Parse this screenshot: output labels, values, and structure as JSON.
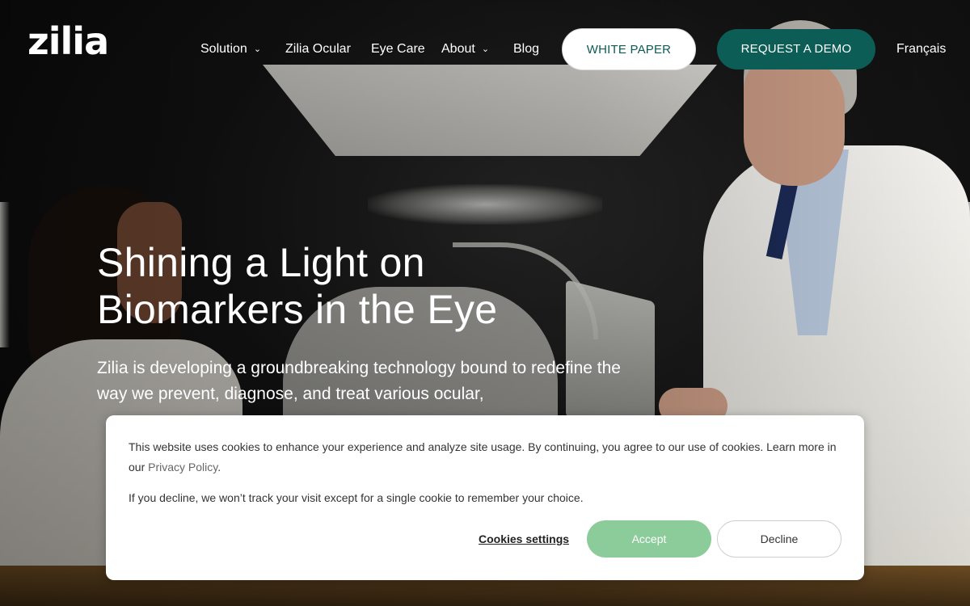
{
  "brand": {
    "logo_text": "zilia"
  },
  "nav": {
    "items": [
      {
        "label": "Solution",
        "has_dropdown": true
      },
      {
        "label": "Zilia Ocular",
        "has_dropdown": false
      },
      {
        "label": "Eye Care",
        "has_dropdown": false
      },
      {
        "label": "About",
        "has_dropdown": true
      },
      {
        "label": "Blog",
        "has_dropdown": false
      }
    ],
    "white_paper_label": "WHITE PAPER",
    "request_demo_label": "REQUEST A DEMO",
    "language_label": "Français"
  },
  "hero": {
    "title_line1": "Shining a Light on",
    "title_line2": "Biomarkers in the Eye",
    "description": "Zilia is developing a groundbreaking technology bound to redefine the way we prevent, diagnose, and treat various ocular,"
  },
  "cookie_banner": {
    "text_main": "This website uses cookies to enhance your experience and analyze site usage. By continuing, you agree to our use of cookies. Learn more in our ",
    "privacy_link": "Privacy Policy",
    "text_after_link": ".",
    "text_decline_note": "If you decline, we won’t track your visit except for a single cookie to remember your choice.",
    "settings_label": "Cookies settings",
    "accept_label": "Accept",
    "decline_label": "Decline"
  },
  "icons": {
    "dropdown": "chevron-down-icon"
  },
  "colors": {
    "brand_teal": "#0c5d56",
    "accept_green": "#8ccb9a"
  }
}
